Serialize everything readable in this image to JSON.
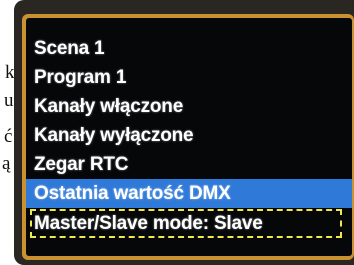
{
  "margin_text": [
    "k",
    "u",
    "ć",
    "ą"
  ],
  "screen": {
    "menu_items": [
      {
        "label": "Scena 1",
        "state": "normal"
      },
      {
        "label": "Program 1",
        "state": "normal"
      },
      {
        "label": "Kanały włączone",
        "state": "normal"
      },
      {
        "label": "Kanały wyłączone",
        "state": "normal"
      },
      {
        "label": "Zegar RTC",
        "state": "normal"
      },
      {
        "label": "Ostatnia wartość DMX",
        "state": "selected"
      },
      {
        "label": "Master/Slave mode: Slave",
        "state": "focused"
      }
    ],
    "colors": {
      "background": "#050708",
      "text": "#ffffff",
      "selected_bar": "#2f7ad9",
      "focus_border": "#f2e84c",
      "frame": "#c9912f"
    }
  }
}
